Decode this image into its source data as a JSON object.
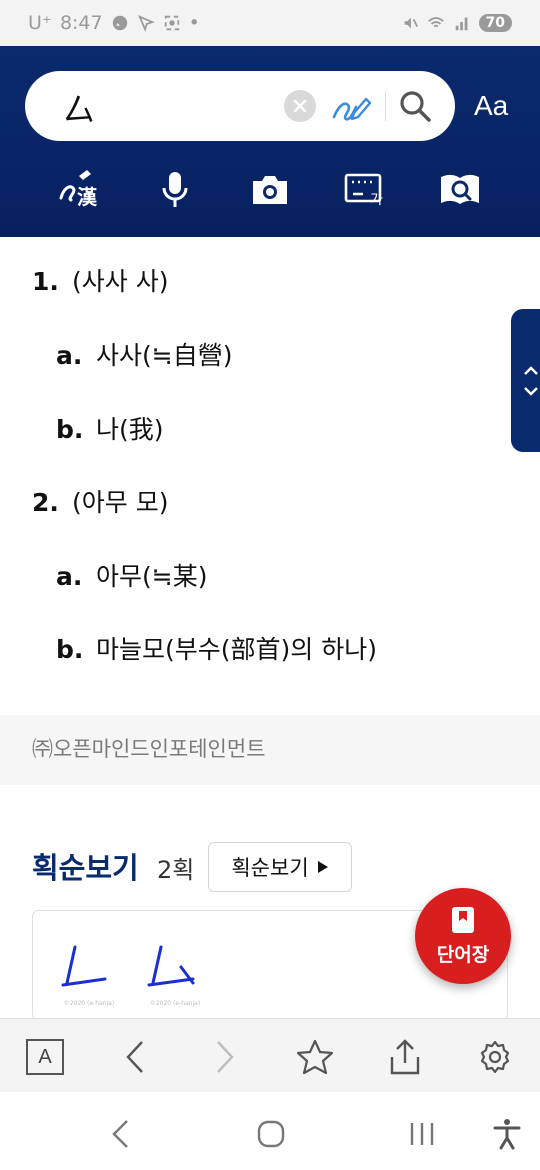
{
  "status_bar": {
    "carrier": "U⁺",
    "time": "8:47",
    "battery": "70"
  },
  "search": {
    "value": "厶"
  },
  "header": {
    "font_size_label": "Aa"
  },
  "tools": [
    {
      "icon": "handwriting-hanja-icon"
    },
    {
      "icon": "microphone-icon"
    },
    {
      "icon": "camera-icon"
    },
    {
      "icon": "keyboard-icon"
    },
    {
      "icon": "book-search-icon"
    }
  ],
  "meanings": [
    {
      "number": "1.",
      "text": "(사사 사)"
    },
    {
      "letter": "a.",
      "text": "사사(≒自營)"
    },
    {
      "letter": "b.",
      "text": "나(我)"
    },
    {
      "number": "2.",
      "text": "(아무 모)"
    },
    {
      "letter": "a.",
      "text": "아무(≒某)"
    },
    {
      "letter": "b.",
      "text": "마늘모(부수(部首)의 하나)"
    }
  ],
  "copyright": "㈜오픈마인드인포테인먼트",
  "stroke_order": {
    "title": "획순보기",
    "count": "2획",
    "button_label": "획순보기",
    "images": [
      {
        "caption": "©2020 (e-hanja)"
      },
      {
        "caption": "©2020 (e-hanja)"
      }
    ]
  },
  "fab": {
    "label": "단어장"
  },
  "toolbar": {
    "font_button": "A"
  },
  "colors": {
    "header_bg": "#0a2a6e",
    "accent_red": "#d81e1e",
    "stroke_blue": "#1a2fd0"
  }
}
